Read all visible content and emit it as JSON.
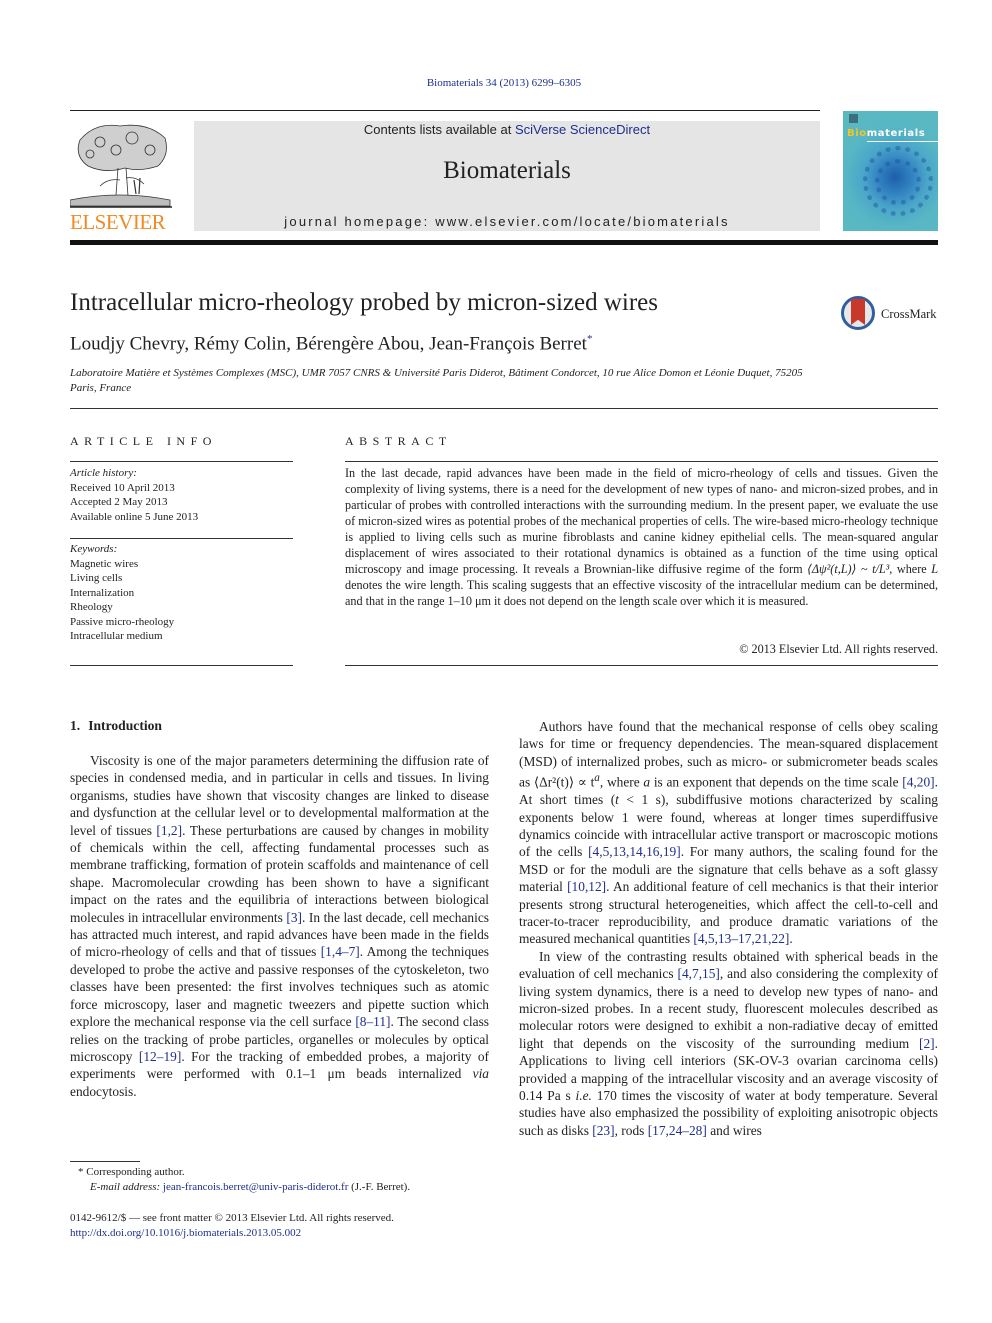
{
  "header": {
    "citation": "Biomaterials 34 (2013) 6299–6305",
    "publisher_wordmark": "ELSEVIER",
    "contents_prefix": "Contents lists available at ",
    "contents_link": "SciVerse ScienceDirect",
    "journal_name": "Biomaterials",
    "homepage_label": "journal homepage: www.elsevier.com/locate/biomaterials",
    "cover": {
      "title_highlight": "Bio",
      "title_rest": "materials",
      "accent_color": "#f5c623",
      "background_color": "#58b7c4"
    },
    "wordmark_color": "#f08a24",
    "link_color": "#1f2f8c"
  },
  "article": {
    "title": "Intracellular micro-rheology probed by micron-sized wires",
    "authors": "Loudjy Chevry, Rémy Colin, Bérengère Abou, Jean-François Berret",
    "author_mark": "*",
    "affiliation": "Laboratoire Matière et Systèmes Complexes (MSC), UMR 7057 CNRS & Université Paris Diderot, Bâtiment Condorcet, 10 rue Alice Domon et Léonie Duquet, 75205 Paris, France",
    "crossmark_label": "CrossMark"
  },
  "article_info": {
    "heading": "ARTICLE INFO",
    "history_label": "Article history:",
    "history": [
      "Received 10 April 2013",
      "Accepted 2 May 2013",
      "Available online 5 June 2013"
    ],
    "keywords_label": "Keywords:",
    "keywords": [
      "Magnetic wires",
      "Living cells",
      "Internalization",
      "Rheology",
      "Passive micro-rheology",
      "Intracellular medium"
    ]
  },
  "abstract": {
    "heading": "ABSTRACT",
    "text_1": "In the last decade, rapid advances have been made in the field of micro-rheology of cells and tissues. Given the complexity of living systems, there is a need for the development of new types of nano- and micron-sized probes, and in particular of probes with controlled interactions with the surrounding medium. In the present paper, we evaluate the use of micron-sized wires as potential probes of the mechanical properties of cells. The wire-based micro-rheology technique is applied to living cells such as murine fibroblasts and canine kidney epithelial cells. The mean-squared angular displacement of wires associated to their rotational dynamics is obtained as a function of the time using optical microscopy and image processing. It reveals a Brownian-like diffusive regime of the form ",
    "formula": "⟨Δψ²(t,L)⟩ ~ t/L³",
    "text_2": ", where ",
    "var_L": "L",
    "text_3": " denotes the wire length. This scaling suggests that an effective viscosity of the intracellular medium can be determined, and that in the range 1–10 μm it does not depend on the length scale over which it is measured.",
    "copyright": "© 2013 Elsevier Ltd. All rights reserved."
  },
  "body": {
    "section_number": "1.",
    "section_title": "Introduction",
    "left_p1": [
      {
        "t": "Viscosity is one of the major parameters determining the diffusion rate of species in condensed media, and in particular in cells and tissues. In living organisms, studies have shown that viscosity changes are linked to disease and dysfunction at the cellular level or to developmental malformation at the level of tissues "
      },
      {
        "ref": "[1,2]"
      },
      {
        "t": ". These perturbations are caused by changes in mobility of chemicals within the cell, affecting fundamental processes such as membrane trafficking, formation of protein scaffolds and maintenance of cell shape. Macromolecular crowding has been shown to have a significant impact on the rates and the equilibria of interactions between biological molecules in intracellular environments "
      },
      {
        "ref": "[3]"
      },
      {
        "t": ". In the last decade, cell mechanics has attracted much interest, and rapid advances have been made in the fields of micro-rheology of cells and that of tissues "
      },
      {
        "ref": "[1,4–7]"
      },
      {
        "t": ". Among the techniques developed to probe the active and passive responses of the cytoskeleton, two classes have been presented: the first involves techniques such as atomic force microscopy, laser and magnetic tweezers and pipette suction which explore the mechanical response via the cell surface "
      },
      {
        "ref": "[8–11]"
      },
      {
        "t": ". The second class relies on the tracking of probe particles, organelles or molecules by optical microscopy "
      },
      {
        "ref": "[12–19]"
      },
      {
        "t": ". For the tracking of embedded probes, a majority of experiments were performed with 0.1–1 μm beads internalized "
      },
      {
        "i": "via"
      },
      {
        "t": " endocytosis."
      }
    ],
    "right_p1": [
      {
        "t": "Authors have found that the mechanical response of cells obey scaling laws for time or frequency dependencies. The mean-squared displacement (MSD) of internalized probes, such as micro- or submicrometer beads scales as ⟨Δr²(t)⟩ ∝ t"
      },
      {
        "sup": "a"
      },
      {
        "t": ", where "
      },
      {
        "i": "a"
      },
      {
        "t": " is an exponent that depends on the time scale "
      },
      {
        "ref": "[4,20]"
      },
      {
        "t": ". At short times ("
      },
      {
        "i": "t"
      },
      {
        "t": " < 1 s), subdiffusive motions characterized by scaling exponents below 1 were found, whereas at longer times superdiffusive dynamics coincide with intracellular active transport or macroscopic motions of the cells "
      },
      {
        "ref": "[4,5,13,14,16,19]"
      },
      {
        "t": ". For many authors, the scaling found for the MSD or for the moduli are the signature that cells behave as a soft glassy material "
      },
      {
        "ref": "[10,12]"
      },
      {
        "t": ". An additional feature of cell mechanics is that their interior presents strong structural heterogeneities, which affect the cell-to-cell and tracer-to-tracer reproducibility, and produce dramatic variations of the measured mechanical quantities "
      },
      {
        "ref": "[4,5,13–17,21,22]"
      },
      {
        "t": "."
      }
    ],
    "right_p2": [
      {
        "t": "In view of the contrasting results obtained with spherical beads in the evaluation of cell mechanics "
      },
      {
        "ref": "[4,7,15]"
      },
      {
        "t": ", and also considering the complexity of living system dynamics, there is a need to develop new types of nano- and micron-sized probes. In a recent study, fluorescent molecules described as molecular rotors were designed to exhibit a non-radiative decay of emitted light that depends on the viscosity of the surrounding medium "
      },
      {
        "ref": "[2]"
      },
      {
        "t": ". Applications to living cell interiors (SK-OV-3 ovarian carcinoma cells) provided a mapping of the intracellular viscosity and an average viscosity of 0.14 Pa s "
      },
      {
        "i": "i.e."
      },
      {
        "t": " 170 times the viscosity of water at body temperature. Several studies have also emphasized the possibility of exploiting anisotropic objects such as disks "
      },
      {
        "ref": "[23]"
      },
      {
        "t": ", rods "
      },
      {
        "ref": "[17,24–28]"
      },
      {
        "t": " and wires"
      }
    ]
  },
  "footnote": {
    "mark": "*",
    "corresponding": "Corresponding author.",
    "email_label": "E-mail address:",
    "email": "jean-francois.berret@univ-paris-diderot.fr",
    "email_suffix": "(J.-F. Berret)."
  },
  "front_matter": {
    "issn_line": "0142-9612/$ — see front matter © 2013 Elsevier Ltd. All rights reserved.",
    "doi": "http://dx.doi.org/10.1016/j.biomaterials.2013.05.002"
  }
}
